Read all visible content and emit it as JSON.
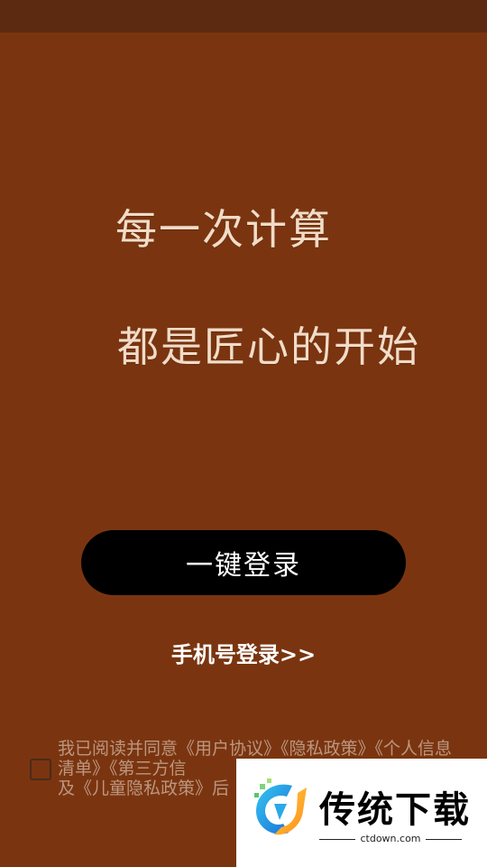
{
  "headline": {
    "line1": "每一次计算",
    "line2": "都是匠心的开始"
  },
  "login": {
    "one_click_label": "一键登录",
    "phone_login_label": "手机号登录>>"
  },
  "agreement": {
    "prefix": "我已阅读并同意",
    "user_agreement": "《用户协议》",
    "privacy_policy": "《隐私政策》",
    "personal_info_list": "《个人信息清单》",
    "third_party": "《第三方信",
    "and": "及",
    "child_privacy": "《儿童隐私政策》",
    "suffix": "后"
  },
  "watermark": {
    "title": "传统下载",
    "url": "ctdown.com"
  },
  "colors": {
    "background": "#7a3510",
    "status_bar": "#5c2a10",
    "headline_text": "#f1dcc8",
    "button": "#000000"
  }
}
